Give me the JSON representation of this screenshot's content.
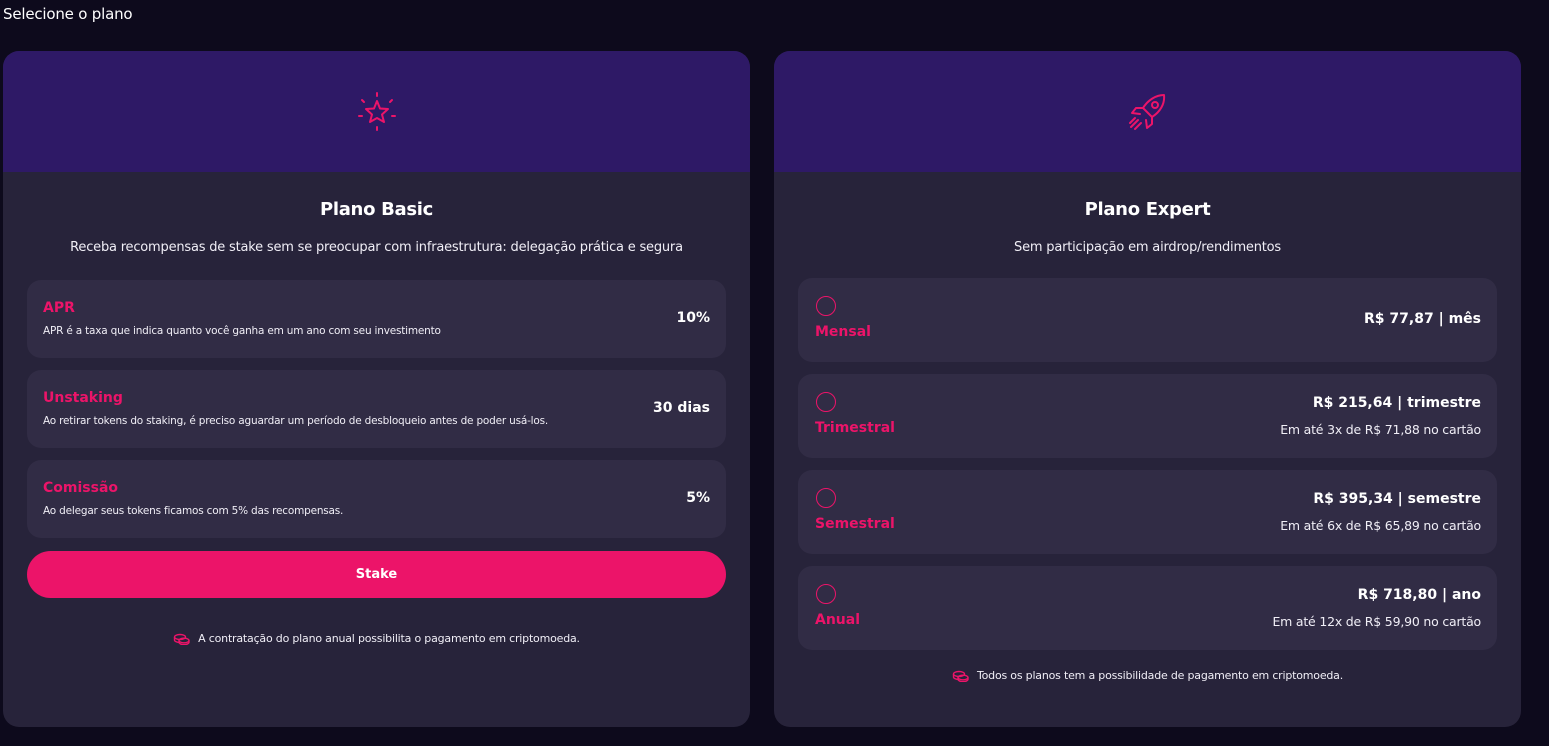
{
  "page": {
    "heading": "Selecione o plano"
  },
  "colors": {
    "accent": "#ec1469",
    "header": "#2e1966",
    "card": "#27233a",
    "row": "#312c45",
    "background": "#0d0a1c"
  },
  "basic": {
    "icon": "star-icon",
    "title": "Plano Basic",
    "subtitle": "Receba recompensas de stake sem se preocupar com infraestrutura: delegação prática e segura",
    "features": [
      {
        "name": "APR",
        "description": "APR é a taxa que indica quanto você ganha em um ano com seu investimento",
        "value": "10%"
      },
      {
        "name": "Unstaking",
        "description": "Ao retirar tokens do staking, é preciso aguardar um período de desbloqueio antes de poder usá-los.",
        "value": "30 dias"
      },
      {
        "name": "Comissão",
        "description": "Ao delegar seus tokens ficamos com 5% das recompensas.",
        "value": "5%"
      }
    ],
    "button_label": "Stake",
    "footnote": "A contratação do plano anual possibilita o pagamento em criptomoeda.",
    "footnote_icon": "coins-icon"
  },
  "expert": {
    "icon": "rocket-icon",
    "title": "Plano Expert",
    "subtitle": "Sem participação em airdrop/rendimentos",
    "plans": [
      {
        "name": "Mensal",
        "price": "R$ 77,87 | mês",
        "installment": "",
        "selected": false
      },
      {
        "name": "Trimestral",
        "price": "R$ 215,64 | trimestre",
        "installment": "Em até 3x de R$ 71,88 no cartão",
        "selected": false
      },
      {
        "name": "Semestral",
        "price": "R$ 395,34 | semestre",
        "installment": "Em até 6x de R$ 65,89 no cartão",
        "selected": false
      },
      {
        "name": "Anual",
        "price": "R$ 718,80 | ano",
        "installment": "Em até 12x de R$ 59,90 no cartão",
        "selected": false
      }
    ],
    "footnote": "Todos os planos tem a possibilidade de pagamento em criptomoeda.",
    "footnote_icon": "coins-icon"
  }
}
